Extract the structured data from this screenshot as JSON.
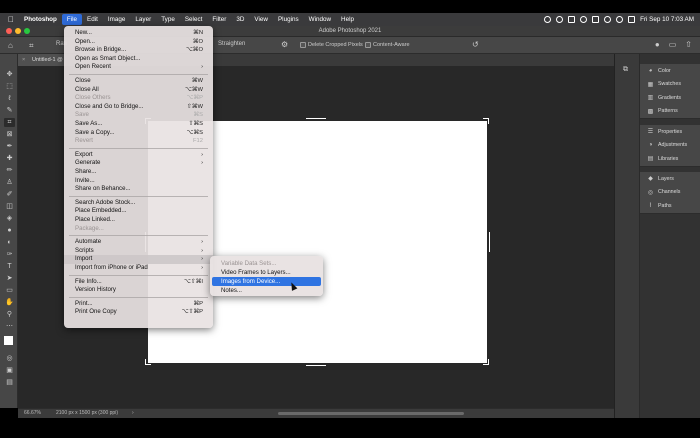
{
  "menubar": {
    "apple": "",
    "app": "Photoshop",
    "items": [
      "File",
      "Edit",
      "Image",
      "Layer",
      "Type",
      "Select",
      "Filter",
      "3D",
      "View",
      "Plugins",
      "Window",
      "Help"
    ],
    "datetime": "Fri Sep 10  7:03 AM"
  },
  "window": {
    "title": "Adobe Photoshop 2021"
  },
  "options": {
    "ratio": "Rati",
    "straighten": "Straighten",
    "delete_cropped": "Delete Cropped Pixels",
    "content_aware": "Content-Aware"
  },
  "document_tab": {
    "label": "Untitled-1 @"
  },
  "status": {
    "zoom": "66.67%",
    "dims": "2100 px x 1500 px (300 ppi)",
    "arrow": "›"
  },
  "file_menu": [
    {
      "label": "New...",
      "shortcut": "⌘N",
      "enabled": true
    },
    {
      "label": "Open...",
      "shortcut": "⌘O",
      "enabled": true
    },
    {
      "label": "Browse in Bridge...",
      "shortcut": "⌥⌘O",
      "enabled": true
    },
    {
      "label": "Open as Smart Object...",
      "shortcut": "",
      "enabled": true
    },
    {
      "label": "Open Recent",
      "shortcut": "›",
      "enabled": true
    },
    {
      "sep": true
    },
    {
      "label": "Close",
      "shortcut": "⌘W",
      "enabled": true
    },
    {
      "label": "Close All",
      "shortcut": "⌥⌘W",
      "enabled": true
    },
    {
      "label": "Close Others",
      "shortcut": "⌥⌘P",
      "enabled": false
    },
    {
      "label": "Close and Go to Bridge...",
      "shortcut": "⇧⌘W",
      "enabled": true
    },
    {
      "label": "Save",
      "shortcut": "⌘S",
      "enabled": false
    },
    {
      "label": "Save As...",
      "shortcut": "⇧⌘S",
      "enabled": true
    },
    {
      "label": "Save a Copy...",
      "shortcut": "⌥⌘S",
      "enabled": true
    },
    {
      "label": "Revert",
      "shortcut": "F12",
      "enabled": false
    },
    {
      "sep": true
    },
    {
      "label": "Export",
      "shortcut": "›",
      "enabled": true
    },
    {
      "label": "Generate",
      "shortcut": "›",
      "enabled": true
    },
    {
      "label": "Share...",
      "shortcut": "",
      "enabled": true
    },
    {
      "label": "Invite...",
      "shortcut": "",
      "enabled": true
    },
    {
      "label": "Share on Behance...",
      "shortcut": "",
      "enabled": true
    },
    {
      "sep": true
    },
    {
      "label": "Search Adobe Stock...",
      "shortcut": "",
      "enabled": true
    },
    {
      "label": "Place Embedded...",
      "shortcut": "",
      "enabled": true
    },
    {
      "label": "Place Linked...",
      "shortcut": "",
      "enabled": true
    },
    {
      "label": "Package...",
      "shortcut": "",
      "enabled": false
    },
    {
      "sep": true
    },
    {
      "label": "Automate",
      "shortcut": "›",
      "enabled": true
    },
    {
      "label": "Scripts",
      "shortcut": "›",
      "enabled": true
    },
    {
      "label": "Import",
      "shortcut": "›",
      "enabled": true,
      "highlight": true
    },
    {
      "label": "Import from iPhone or iPad",
      "shortcut": "›",
      "enabled": true
    },
    {
      "sep": true
    },
    {
      "label": "File Info...",
      "shortcut": "⌥⇧⌘I",
      "enabled": true
    },
    {
      "label": "Version History",
      "shortcut": "",
      "enabled": true
    },
    {
      "sep": true
    },
    {
      "label": "Print...",
      "shortcut": "⌘P",
      "enabled": true
    },
    {
      "label": "Print One Copy",
      "shortcut": "⌥⇧⌘P",
      "enabled": true
    }
  ],
  "import_submenu": [
    {
      "label": "Variable Data Sets...",
      "enabled": false,
      "selected": false
    },
    {
      "label": "Video Frames to Layers...",
      "enabled": true,
      "selected": false
    },
    {
      "label": "Images from Device...",
      "enabled": true,
      "selected": true
    },
    {
      "label": "Notes...",
      "enabled": true,
      "selected": false
    }
  ],
  "panels": {
    "group1": [
      "Color",
      "Swatches",
      "Gradients",
      "Patterns"
    ],
    "group2": [
      "Properties",
      "Adjustments",
      "Libraries"
    ],
    "group3": [
      "Layers",
      "Channels",
      "Paths"
    ]
  },
  "colors": {
    "menu_highlight": "#2f74e2",
    "workspace": "#282828",
    "canvas": "#ffffff"
  }
}
